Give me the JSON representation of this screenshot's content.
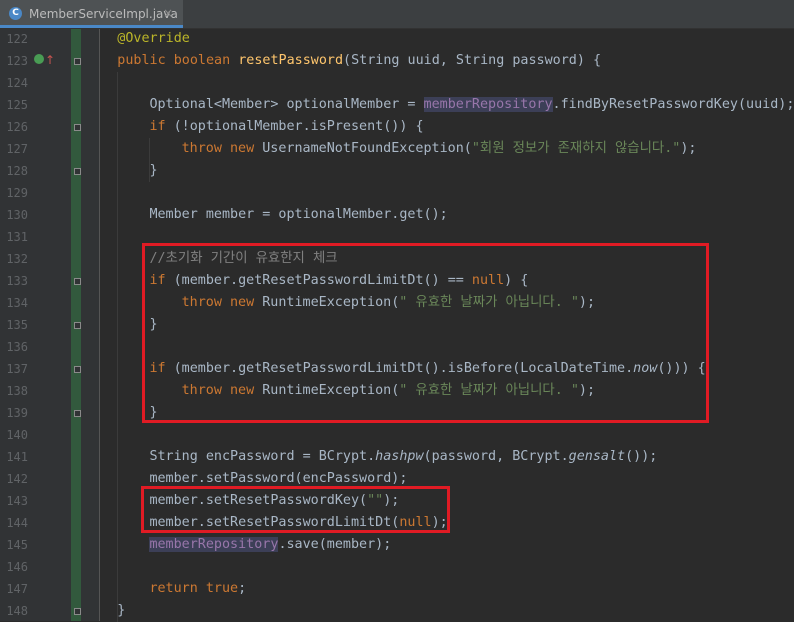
{
  "tab": {
    "filename": "MemberServiceImpl.java",
    "icon": "C",
    "close": "×"
  },
  "lines": [
    {
      "n": "122",
      "indent": 2,
      "t": [
        [
          "anno",
          "@Override"
        ]
      ]
    },
    {
      "n": "123",
      "indent": 2,
      "t": [
        [
          "kw",
          "public boolean "
        ],
        [
          "fn",
          "resetPassword"
        ],
        [
          "",
          "(String uuid, String password) {"
        ]
      ],
      "gutter_icon": "override-method-icon"
    },
    {
      "n": "124",
      "indent": 0,
      "t": []
    },
    {
      "n": "125",
      "indent": 3,
      "t": [
        [
          "",
          "Optional<Member> optionalMember = "
        ],
        [
          "field hl",
          "memberRepository"
        ],
        [
          "",
          ".findByResetPasswordKey(uuid);"
        ]
      ]
    },
    {
      "n": "126",
      "indent": 3,
      "t": [
        [
          "kw",
          "if "
        ],
        [
          "",
          "(!optionalMember.isPresent()) {"
        ]
      ]
    },
    {
      "n": "127",
      "indent": 4,
      "t": [
        [
          "kw",
          "throw new "
        ],
        [
          "",
          "UsernameNotFoundException("
        ],
        [
          "str",
          "\"회원 정보가 존재하지 않습니다.\""
        ],
        [
          "",
          ");"
        ]
      ]
    },
    {
      "n": "128",
      "indent": 3,
      "t": [
        [
          "",
          "}"
        ]
      ]
    },
    {
      "n": "129",
      "indent": 0,
      "t": []
    },
    {
      "n": "130",
      "indent": 3,
      "t": [
        [
          "",
          "Member member = optionalMember.get();"
        ]
      ]
    },
    {
      "n": "131",
      "indent": 0,
      "t": []
    },
    {
      "n": "132",
      "indent": 3,
      "t": [
        [
          "cmt",
          "//초기화 기간이 유효한지 체크"
        ]
      ]
    },
    {
      "n": "133",
      "indent": 3,
      "t": [
        [
          "kw",
          "if "
        ],
        [
          "",
          "(member.getResetPasswordLimitDt() == "
        ],
        [
          "kw",
          "null"
        ],
        [
          "",
          ") {"
        ]
      ]
    },
    {
      "n": "134",
      "indent": 4,
      "t": [
        [
          "kw",
          "throw new "
        ],
        [
          "",
          "RuntimeException("
        ],
        [
          "str",
          "\" 유효한 날짜가 아닙니다. \""
        ],
        [
          "",
          ");"
        ]
      ]
    },
    {
      "n": "135",
      "indent": 3,
      "t": [
        [
          "",
          "}"
        ]
      ]
    },
    {
      "n": "136",
      "indent": 0,
      "t": []
    },
    {
      "n": "137",
      "indent": 3,
      "t": [
        [
          "kw",
          "if "
        ],
        [
          "",
          "(member.getResetPasswordLimitDt().isBefore(LocalDateTime."
        ],
        [
          "ital",
          "now"
        ],
        [
          "",
          "())) {"
        ]
      ]
    },
    {
      "n": "138",
      "indent": 4,
      "t": [
        [
          "kw",
          "throw new "
        ],
        [
          "",
          "RuntimeException("
        ],
        [
          "str",
          "\" 유효한 날짜가 아닙니다. \""
        ],
        [
          "",
          ");"
        ]
      ]
    },
    {
      "n": "139",
      "indent": 3,
      "t": [
        [
          "",
          "}"
        ]
      ]
    },
    {
      "n": "140",
      "indent": 0,
      "t": []
    },
    {
      "n": "141",
      "indent": 3,
      "t": [
        [
          "",
          "String encPassword = BCrypt."
        ],
        [
          "ital",
          "hashpw"
        ],
        [
          "",
          "(password, BCrypt."
        ],
        [
          "ital",
          "gensalt"
        ],
        [
          "",
          "());"
        ]
      ]
    },
    {
      "n": "142",
      "indent": 3,
      "t": [
        [
          "",
          "member.setPassword(encPassword);"
        ]
      ]
    },
    {
      "n": "143",
      "indent": 3,
      "t": [
        [
          "",
          "member.setResetPasswordKey("
        ],
        [
          "str",
          "\"\""
        ],
        [
          "",
          ");"
        ]
      ]
    },
    {
      "n": "144",
      "indent": 3,
      "t": [
        [
          "",
          "member.setResetPasswordLimitDt("
        ],
        [
          "kw",
          "null"
        ],
        [
          "",
          ");"
        ]
      ]
    },
    {
      "n": "145",
      "indent": 3,
      "t": [
        [
          "field hl",
          "memberRepository"
        ],
        [
          "",
          ".save(member);"
        ]
      ]
    },
    {
      "n": "146",
      "indent": 0,
      "t": []
    },
    {
      "n": "147",
      "indent": 3,
      "t": [
        [
          "kw",
          "return true"
        ],
        [
          "",
          ";"
        ]
      ]
    },
    {
      "n": "148",
      "indent": 2,
      "t": [
        [
          "",
          "}"
        ]
      ]
    }
  ],
  "colors": {
    "keyword": "#cc7832",
    "string": "#6a8759",
    "annotation": "#bbb529",
    "method": "#ffc66d",
    "field": "#9876aa",
    "comment": "#808080",
    "text": "#a9b7c6",
    "highlight_box": "#e01b24"
  }
}
